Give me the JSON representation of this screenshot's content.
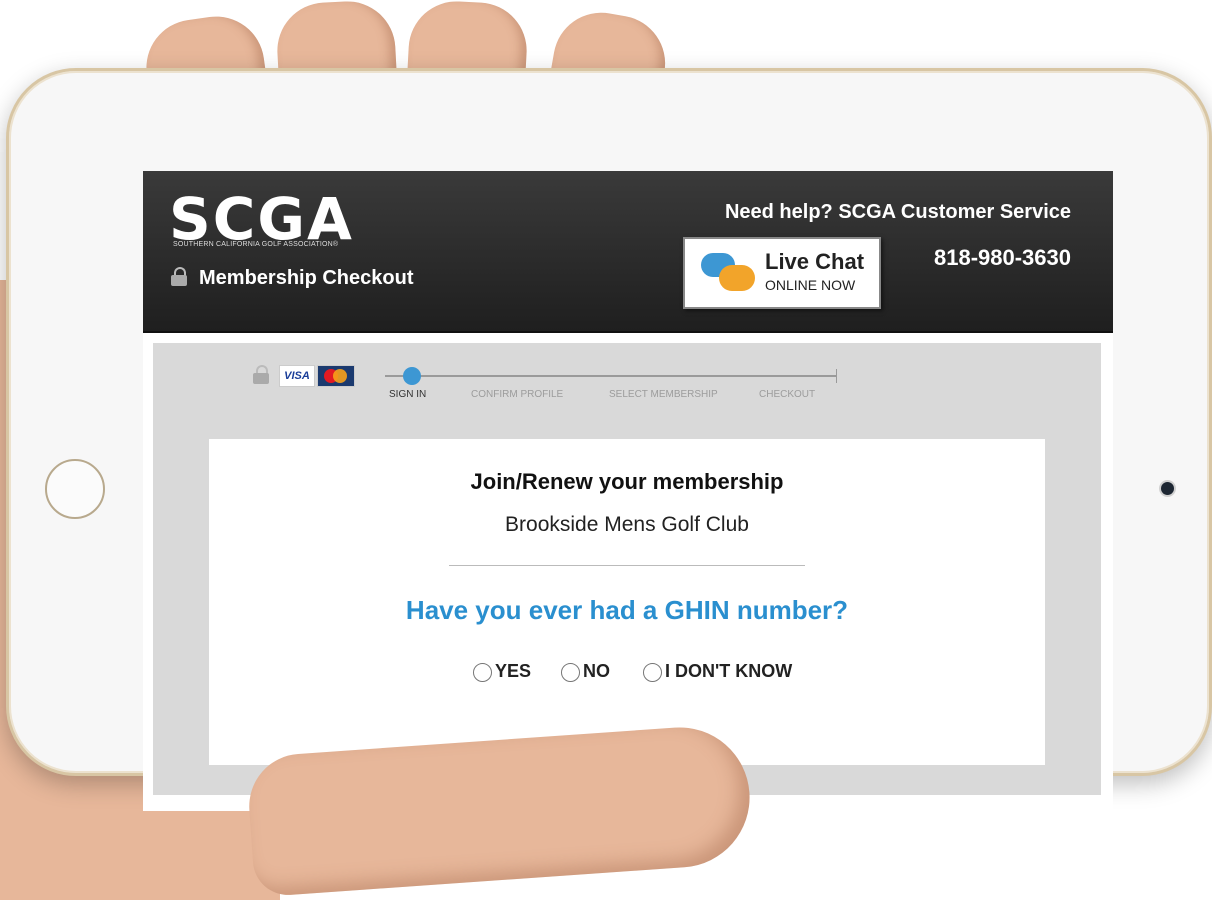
{
  "header": {
    "logo": "SCGA",
    "logo_tagline": "SOUTHERN CALIFORNIA GOLF ASSOCIATION®",
    "checkout_title": "Membership Checkout",
    "help_text": "Need help? SCGA Customer Service",
    "chat_label": "Live Chat",
    "chat_status": "ONLINE NOW",
    "phone": "818-980-3630"
  },
  "payment": {
    "visa": "VISA"
  },
  "steps": [
    {
      "label": "SIGN IN",
      "active": true
    },
    {
      "label": "CONFIRM PROFILE",
      "active": false
    },
    {
      "label": "SELECT MEMBERSHIP",
      "active": false
    },
    {
      "label": "CHECKOUT",
      "active": false
    }
  ],
  "card": {
    "title": "Join/Renew your membership",
    "subtitle": "Brookside Mens Golf Club",
    "question": "Have you ever had a GHIN number?",
    "options": [
      "YES",
      "NO",
      "I DON'T KNOW"
    ]
  },
  "colors": {
    "accent": "#2a8fcf",
    "header_bg": "#2b2b2b",
    "content_bg": "#d9d9d9"
  }
}
